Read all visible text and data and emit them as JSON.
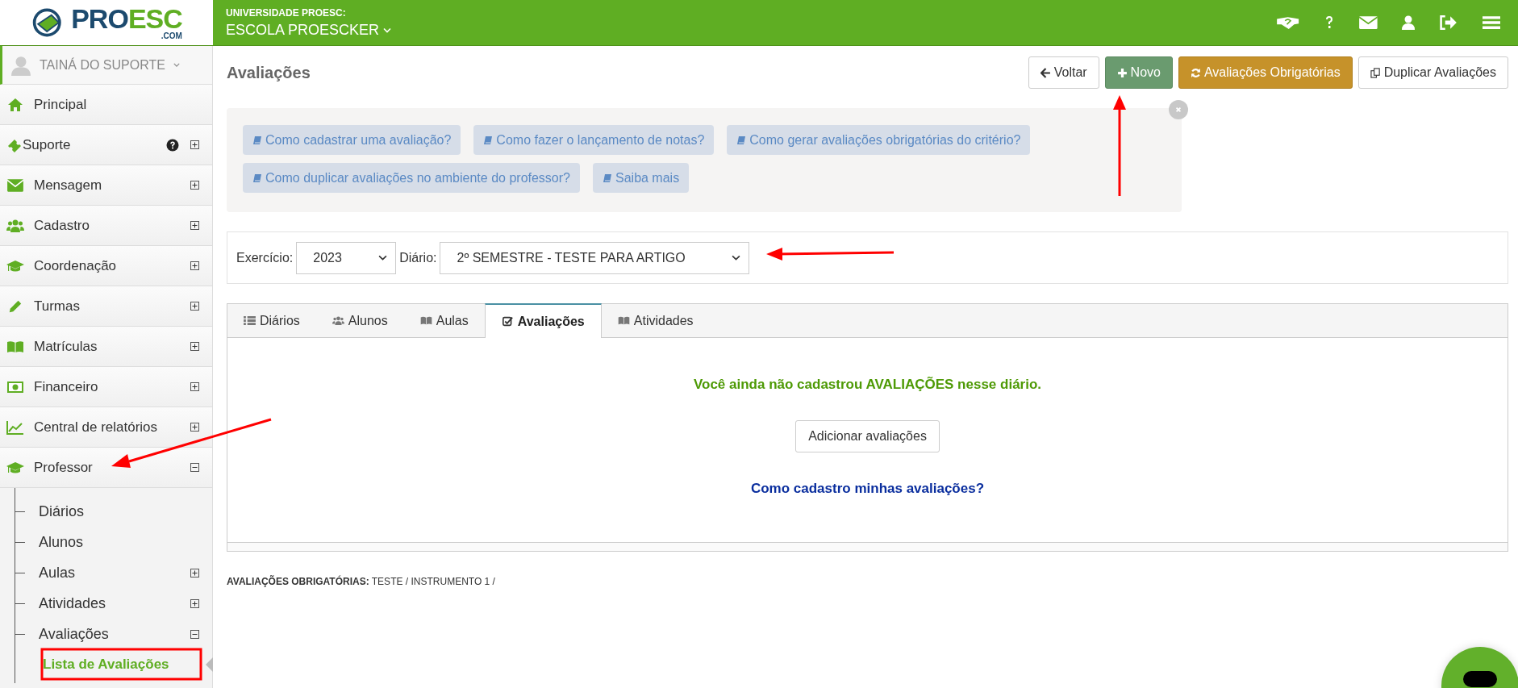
{
  "logo": {
    "brand_main": "PRO",
    "brand_accent": "ESC",
    "domain": ".COM"
  },
  "header": {
    "institution": "UNIVERSIDADE PROESC:",
    "school": "ESCOLA PROESCKER"
  },
  "user": {
    "name": "TAINÁ DO SUPORTE"
  },
  "sidebar": {
    "items": [
      {
        "label": "Principal"
      },
      {
        "label": "Suporte",
        "help": true,
        "expanded": false
      },
      {
        "label": "Mensagem",
        "expanded": false
      },
      {
        "label": "Cadastro",
        "expanded": false
      },
      {
        "label": "Coordenação",
        "expanded": false
      },
      {
        "label": "Turmas",
        "expanded": false
      },
      {
        "label": "Matrículas",
        "expanded": false
      },
      {
        "label": "Financeiro",
        "expanded": false
      },
      {
        "label": "Central de relatórios",
        "expanded": false
      },
      {
        "label": "Professor",
        "expanded": true,
        "children": [
          {
            "label": "Diários"
          },
          {
            "label": "Alunos"
          },
          {
            "label": "Aulas",
            "expanded": false
          },
          {
            "label": "Atividades",
            "expanded": false
          },
          {
            "label": "Avaliações",
            "expanded": true,
            "children": [
              {
                "label": "Lista de Avaliações",
                "selected": true
              }
            ]
          }
        ]
      }
    ]
  },
  "page": {
    "title": "Avaliações",
    "actions": [
      {
        "label": "Voltar",
        "kind": "back"
      },
      {
        "label": "Novo",
        "kind": "new"
      },
      {
        "label": "Avaliações Obrigatórias",
        "kind": "required"
      },
      {
        "label": "Duplicar Avaliações",
        "kind": "duplicate"
      }
    ],
    "help_links": [
      "Como cadastrar uma avaliação?",
      "Como fazer o lançamento de notas?",
      "Como gerar avaliações obrigatórias do critério?",
      "Como duplicar avaliações no ambiente do professor?",
      "Saiba mais"
    ],
    "filters": [
      {
        "label": "Exercício:",
        "value": "2023",
        "kind": "short"
      },
      {
        "label": "Diário:",
        "value": "2º SEMESTRE - TESTE PARA ARTIGO",
        "kind": "wide"
      }
    ],
    "tabs": [
      {
        "label": "Diários",
        "selected": false
      },
      {
        "label": "Alunos",
        "selected": false
      },
      {
        "label": "Aulas",
        "selected": false
      },
      {
        "label": "Avaliações",
        "selected": true
      },
      {
        "label": "Atividades",
        "selected": false
      }
    ],
    "empty_message": {
      "before": "Você ainda não cadastrou ",
      "emphasis": "AVALIAÇÕES",
      "after": " nesse diário."
    },
    "add_button": "Adicionar avaliações",
    "help_link": "Como cadastro minhas avaliações?",
    "footer": {
      "label": "AVALIAÇÕES OBRIGATÓRIAS:",
      "value": "TESTE / INSTRUMENTO 1 /"
    }
  }
}
